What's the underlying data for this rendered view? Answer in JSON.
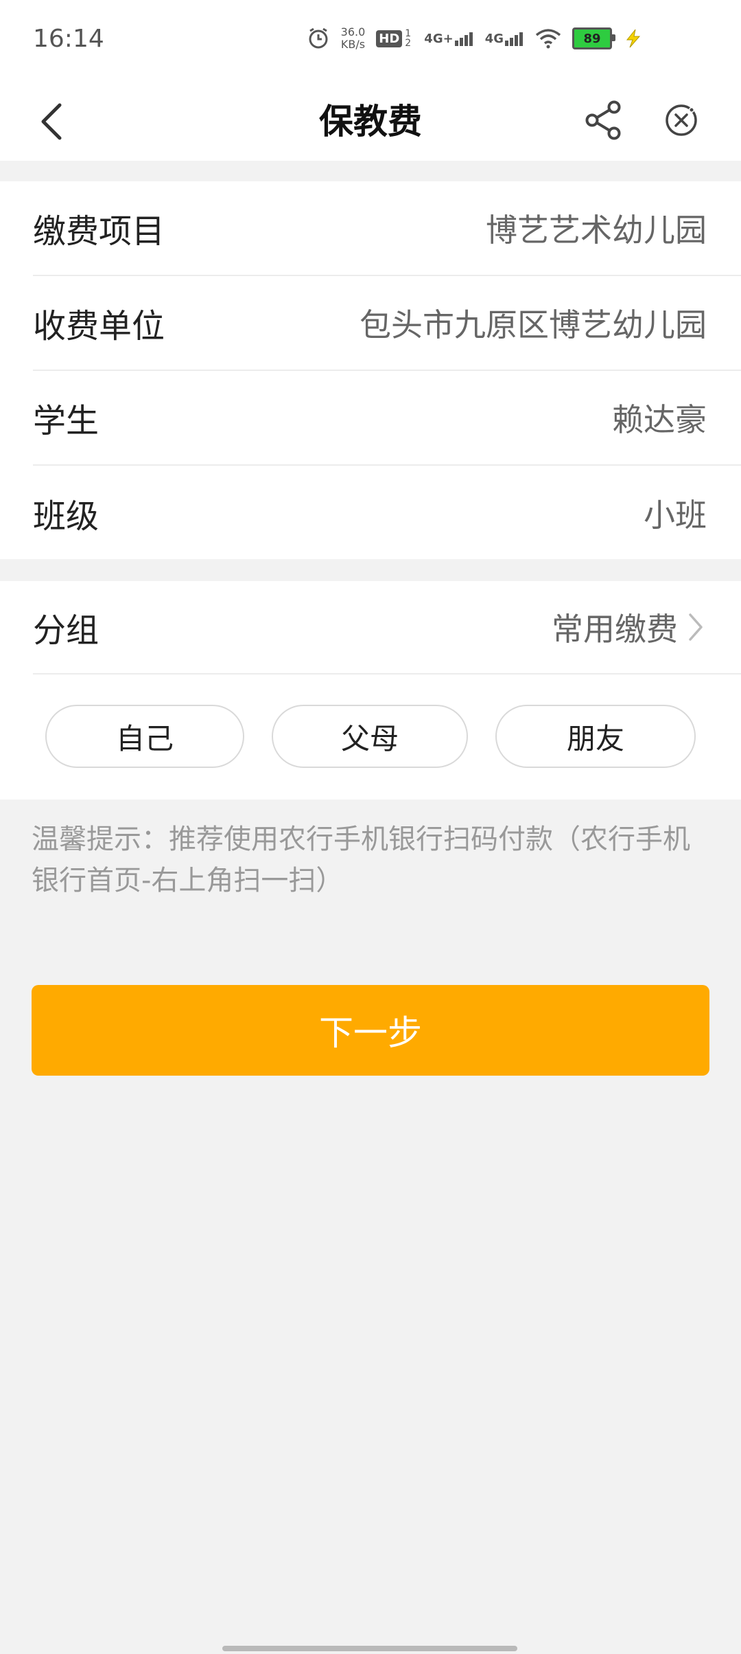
{
  "status": {
    "time": "16:14",
    "speed_value": "36.0",
    "speed_unit": "KB/s",
    "hd": "HD",
    "sim_slots": "1 2",
    "net1": "4G+",
    "net2": "4G",
    "battery": "89"
  },
  "header": {
    "title": "保教费"
  },
  "info_rows": [
    {
      "label": "缴费项目",
      "value": "博艺艺术幼儿园"
    },
    {
      "label": "收费单位",
      "value": "包头市九原区博艺幼儿园"
    },
    {
      "label": "学生",
      "value": "赖达豪"
    },
    {
      "label": "班级",
      "value": "小班"
    }
  ],
  "group": {
    "label": "分组",
    "value": "常用缴费",
    "options": [
      "自己",
      "父母",
      "朋友"
    ]
  },
  "hint": "温馨提示：推荐使用农行手机银行扫码付款（农行手机银行首页-右上角扫一扫）",
  "next_button": "下一步",
  "colors": {
    "accent": "#ffaa00",
    "battery": "#2ecc40"
  }
}
